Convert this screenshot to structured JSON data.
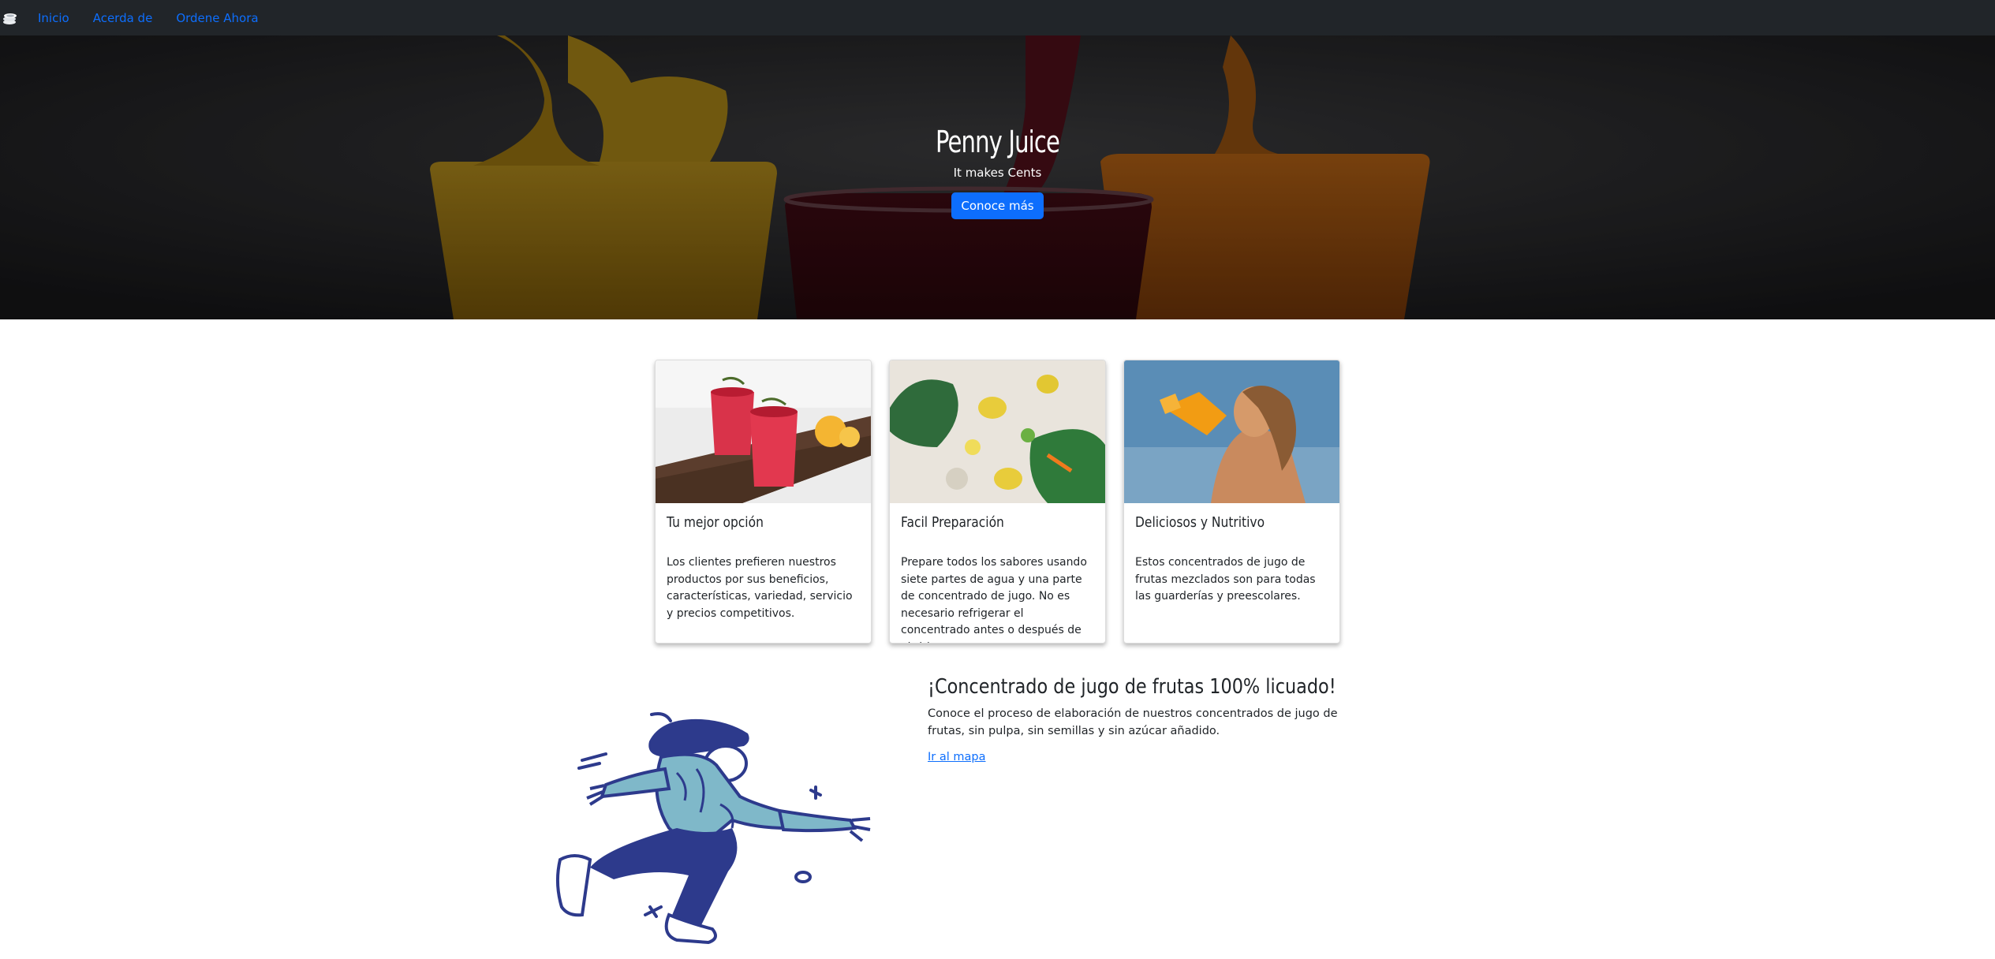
{
  "navbar": {
    "brand_icon": "coins-stack-icon",
    "links": [
      "Inicio",
      "Acerda de",
      "Ordene Ahora"
    ],
    "link_color": "#0d6efd",
    "background": "#212529"
  },
  "hero": {
    "title": "Penny Juice",
    "subtitle": "It makes Cents",
    "button_label": "Conoce más",
    "button_color": "#0d6efd"
  },
  "cards": [
    {
      "image": "red-drinks-photo",
      "title": "Tu mejor opción",
      "text": "Los clientes prefieren nuestros productos por sus beneficios, características, variedad, servicio y precios competitivos."
    },
    {
      "image": "lemons-leaves-photo",
      "title": "Facil Preparación",
      "text": "Prepare todos los sabores usando siete partes de agua y una parte de concentrado de jugo. No es necesario refrigerar el concentrado antes o después de abrirlo."
    },
    {
      "image": "girl-drinking-juice-photo",
      "title": "Deliciosos y Nutritivo",
      "text": "Estos concentrados de jugo de frutas mezclados son para todas las guarderías y preescolares."
    }
  ],
  "feature": {
    "illustration": "running-person-illustration",
    "title": "¡Concentrado de jugo de frutas 100% licuado!",
    "description": "Conoce el proceso de elaboración de nuestros concentrados de jugo de frutas, sin pulpa, sin semillas y sin azúcar añadido.",
    "link_label": "Ir al mapa"
  }
}
